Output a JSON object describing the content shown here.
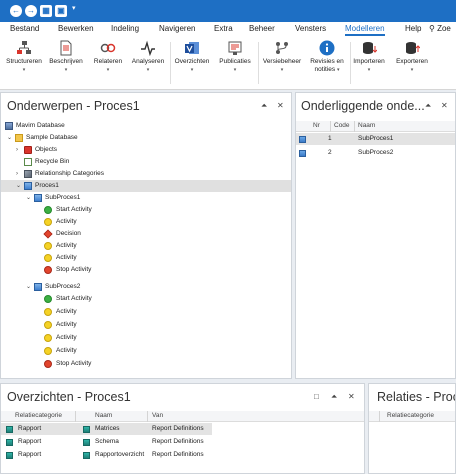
{
  "menu": {
    "tabs": [
      {
        "label": "Bestand"
      },
      {
        "label": "Bewerken"
      },
      {
        "label": "Indeling"
      },
      {
        "label": "Navigeren"
      },
      {
        "label": "Extra"
      },
      {
        "label": "Beheer"
      },
      {
        "label": "Vensters"
      },
      {
        "label": "Modelleren"
      },
      {
        "label": "Help"
      }
    ],
    "search_label": "Zoe",
    "active_tab": "Modelleren",
    "accent_color": "#1e6fc4"
  },
  "ribbon": {
    "buttons": [
      {
        "label": "Structureren",
        "icon": "structure-icon"
      },
      {
        "label": "Beschrijven",
        "icon": "document-icon"
      },
      {
        "label": "Relateren",
        "icon": "relate-icon"
      },
      {
        "label": "Analyseren",
        "icon": "pulse-icon"
      },
      {
        "label": "Overzichten",
        "icon": "visio-icon"
      },
      {
        "label": "Publicaties",
        "icon": "publish-icon"
      },
      {
        "label": "Versiebeheer",
        "icon": "version-icon"
      },
      {
        "label": "Revisies en",
        "label2": "notities",
        "icon": "info-icon"
      },
      {
        "label": "Importeren",
        "icon": "import-icon"
      },
      {
        "label": "Exporteren",
        "icon": "export-icon"
      }
    ]
  },
  "subjects": {
    "title": "Onderwerpen -  Proces1",
    "tree": [
      {
        "label": "Mavim Database"
      },
      {
        "label": "Sample Database"
      },
      {
        "label": "Objects"
      },
      {
        "label": "Recycle Bin"
      },
      {
        "label": "Relationship Categories"
      },
      {
        "label": "Proces1"
      },
      {
        "label": "SubProces1"
      },
      {
        "label": "Start Activity"
      },
      {
        "label": "Activity"
      },
      {
        "label": "Decision"
      },
      {
        "label": "Activity"
      },
      {
        "label": "Activity"
      },
      {
        "label": "Stop Activity"
      },
      {
        "label": "SubProces2"
      },
      {
        "label": "Start Activity"
      },
      {
        "label": "Activity"
      },
      {
        "label": "Activity"
      },
      {
        "label": "Activity"
      },
      {
        "label": "Activity"
      },
      {
        "label": "Stop Activity"
      }
    ]
  },
  "underlying": {
    "title": "Onderliggende onde...",
    "columns": [
      "Nr",
      "Code",
      "Naam"
    ],
    "rows": [
      {
        "nr": "1",
        "code": "",
        "naam": "SubProces1"
      },
      {
        "nr": "2",
        "code": "",
        "naam": "SubProces2"
      }
    ]
  },
  "overviews": {
    "title": "Overzichten - Proces1",
    "columns": [
      "Relatiecategorie",
      "Naam",
      "Van"
    ],
    "rows": [
      {
        "cat": "Rapport",
        "naam": "Matrices",
        "van": "Report Definitions"
      },
      {
        "cat": "Rapport",
        "naam": "Schema",
        "van": "Report Definitions"
      },
      {
        "cat": "Rapport",
        "naam": "Rapportoverzicht",
        "van": "Report Definitions"
      }
    ]
  },
  "relations": {
    "title": "Relaties - Proces",
    "columns": [
      "Relatiecategorie"
    ]
  }
}
